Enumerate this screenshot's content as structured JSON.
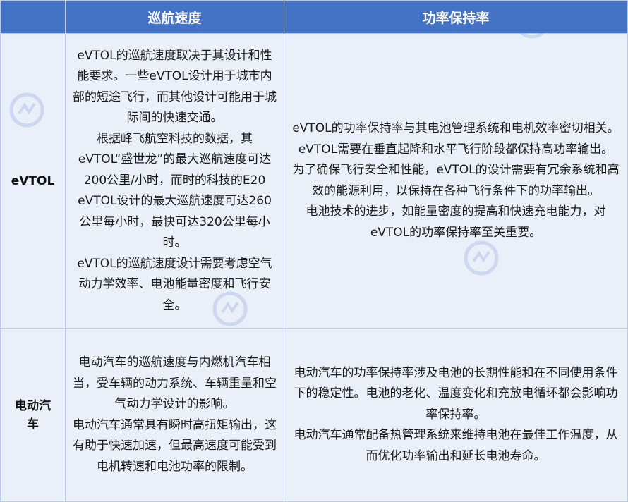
{
  "header": {
    "col0": "",
    "col1": "巡航速度",
    "col2": "功率保持率"
  },
  "rows": [
    {
      "label": "eVTOL",
      "speed": [
        "eVTOL的巡航速度取决于其设计和性能要求。一些eVTOL设计用于城市内部的短途飞行，而其他设计可能用于城际间的快速交通。",
        "根据峰飞航空科技的数据，其eVTOL“盛世龙”的最大巡航速度可达200公里/小时，而时的科技的E20 eVTOL设计的最大巡航速度可达260公里每小时，最快可达320公里每小时。",
        "eVTOL的巡航速度设计需要考虑空气动力学效率、电池能量密度和飞行安全。"
      ],
      "power": [
        "eVTOL的功率保持率与其电池管理系统和电机效率密切相关。eVTOL需要在垂直起降和水平飞行阶段都保持高功率输出。",
        "为了确保飞行安全和性能，eVTOL的设计需要有冗余系统和高效的能源利用，以保持在各种飞行条件下的功率输出。",
        "电池技术的进步，如能量密度的提高和快速充电能力，对eVTOL的功率保持率至关重要。"
      ]
    },
    {
      "label": "电动汽车",
      "speed": [
        "电动汽车的巡航速度与内燃机汽车相当，受车辆的动力系统、车辆重量和空气动力学设计的影响。",
        "电动汽车通常具有瞬时高扭矩输出，这有助于快速加速，但最高速度可能受到电机转速和电池功率的限制。"
      ],
      "power": [
        "电动汽车的功率保持率涉及电池的长期性能和在不同使用条件下的稳定性。电池的老化、温度变化和充放电循环都会影响功率保持率。",
        "电动汽车通常配备热管理系统来维持电池在最佳工作温度，从而优化功率输出和延长电池寿命。"
      ]
    }
  ],
  "colors": {
    "header_bg": "#4472c4",
    "cell_bg": "#eaf0fa",
    "border": "#b9c8e3",
    "watermark": "#4472c4"
  },
  "watermark_icon": "logo-watermark"
}
